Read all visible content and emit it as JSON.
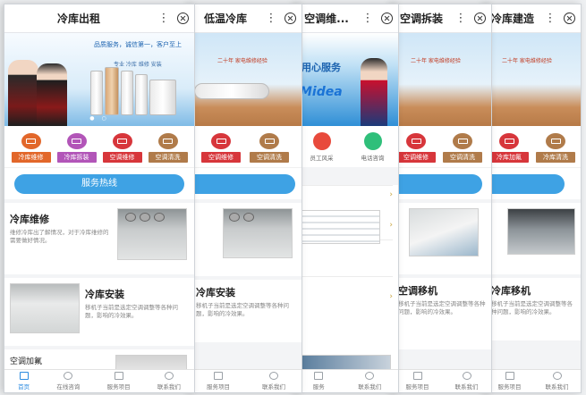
{
  "cards": [
    {
      "title": "冷库出租",
      "banner": {
        "slogan": "品质服务，诚信第一，客户至上",
        "sub": "专业 冷库 维修 安装"
      },
      "categories": [
        {
          "label": "冷库维修",
          "color": "#e2672a"
        },
        {
          "label": "冷库拆装",
          "color": "#b255b8"
        },
        {
          "label": "空调维修",
          "color": "#d7363b"
        },
        {
          "label": "空调清洗",
          "color": "#b07b4a"
        }
      ],
      "hotline": "服务热线",
      "sections": [
        {
          "title": "冷库维修",
          "desc": "维修冷库出了解情况，对于冷库维修的需要做好情况。"
        },
        {
          "title": "冷库安装",
          "desc": "移机子当前是选定空调调整等各种问题，影响的冷效果。"
        },
        {
          "title": "空调加氟",
          "desc": ""
        }
      ],
      "tabs": [
        {
          "label": "首页",
          "icon": "home-icon"
        },
        {
          "label": "在线咨询",
          "icon": "globe-icon"
        },
        {
          "label": "服务项目",
          "icon": "layers-icon"
        },
        {
          "label": "联系我们",
          "icon": "user-icon"
        }
      ]
    },
    {
      "title": "低温冷库",
      "categories": [
        {
          "label": "空调维修",
          "color": "#d7363b"
        },
        {
          "label": "空调清洗",
          "color": "#b07b4a"
        }
      ],
      "banner": {
        "slogan": "二十年 家电维修经验"
      },
      "sections": [
        {
          "title": "冷库安装",
          "desc": "移机子当前是选定空调调整等各种问题，影响的冷效果。"
        }
      ],
      "tabs": [
        {
          "label": "服务项目",
          "icon": "layers-icon"
        },
        {
          "label": "联系我们",
          "icon": "user-icon"
        }
      ]
    },
    {
      "title": "空调维...",
      "banner": {
        "slogan": "用心服务",
        "brand": "Midea"
      },
      "services": [
        {
          "label": "员工风采",
          "color": "#e84a3c"
        },
        {
          "label": "电话咨询",
          "color": "#2fbf7a"
        }
      ],
      "tabs": [
        {
          "label": "服务",
          "icon": "layers-icon"
        },
        {
          "label": "联系我们",
          "icon": "user-icon"
        }
      ]
    },
    {
      "title": "空调拆装",
      "banner": {
        "slogan": "二十年 家电维修经验"
      },
      "categories": [
        {
          "label": "空调维修",
          "color": "#d7363b"
        },
        {
          "label": "空调清洗",
          "color": "#b07b4a"
        }
      ],
      "sections": [
        {
          "title": "空调移机",
          "desc": "移机子当前是选定空调调整等各种问题，影响的冷效果。"
        }
      ],
      "tabs": [
        {
          "label": "服务项目",
          "icon": "layers-icon"
        },
        {
          "label": "联系我们",
          "icon": "user-icon"
        }
      ]
    },
    {
      "title": "冷库建造",
      "banner": {
        "slogan": "二十年 家电维修经验"
      },
      "categories": [
        {
          "label": "冷库加氟",
          "color": "#d7363b"
        },
        {
          "label": "冷库清洗",
          "color": "#b07b4a"
        }
      ],
      "sections": [
        {
          "title": "冷库移机",
          "desc": "移机子当前是选定空调调整等各种问题，影响的冷效果。"
        }
      ],
      "tabs": [
        {
          "label": "服务项目",
          "icon": "layers-icon"
        },
        {
          "label": "联系我们",
          "icon": "user-icon"
        }
      ]
    }
  ]
}
